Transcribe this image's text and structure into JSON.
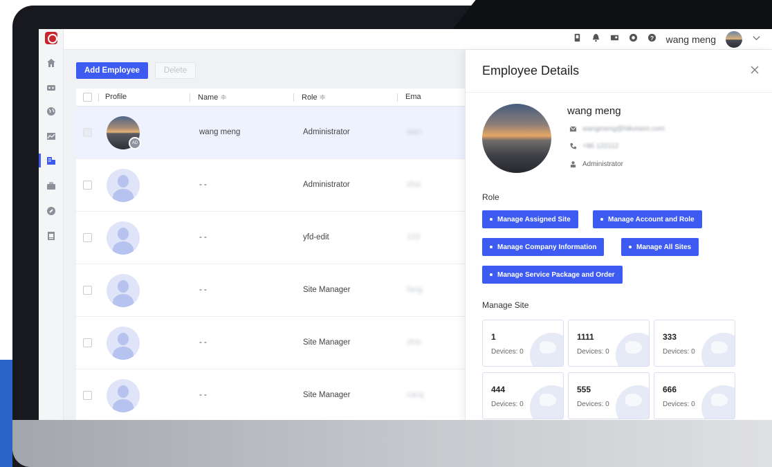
{
  "topbar": {
    "user_name": "wang meng",
    "icons": [
      "device-icon",
      "bell-icon",
      "card-icon",
      "settings-icon",
      "help-icon",
      "chevron-down-icon"
    ]
  },
  "nav": {
    "items": [
      "home-icon",
      "devices-icon",
      "globe-icon",
      "statistics-icon",
      "organization-icon",
      "briefcase-icon",
      "tools-icon",
      "reports-icon"
    ],
    "active": "organization-icon"
  },
  "toolbar": {
    "add_label": "Add Employee",
    "delete_label": "Delete"
  },
  "table": {
    "headers": {
      "profile": "Profile",
      "name": "Name",
      "role": "Role",
      "email": "Ema"
    },
    "sort_glyph": "≑",
    "rows": [
      {
        "name": "wang meng",
        "role": "Administrator",
        "email": "wan",
        "badge": "AD"
      },
      {
        "name": "- -",
        "role": "Administrator",
        "email": "zhsi"
      },
      {
        "name": "- -",
        "role": "yfd-edit",
        "email": "103"
      },
      {
        "name": "- -",
        "role": "Site Manager",
        "email": "fang"
      },
      {
        "name": "- -",
        "role": "Site Manager",
        "email": "zhsi"
      },
      {
        "name": "- -",
        "role": "Site Manager",
        "email": "cacq"
      }
    ]
  },
  "details": {
    "title": "Employee Details",
    "name": "wang meng",
    "email": "wangmeng@hikvision.com",
    "phone": "+86 122112",
    "role": "Administrator",
    "role_heading": "Role",
    "permissions": [
      "Manage Assigned Site",
      "Manage Account and Role",
      "Manage Company Information",
      "Manage All Sites",
      "Manage Service Package and Order"
    ],
    "site_heading": "Manage Site",
    "sites": [
      {
        "name": "1",
        "devices": "Devices: 0"
      },
      {
        "name": "1111",
        "devices": "Devices: 0"
      },
      {
        "name": "333",
        "devices": "Devices: 0"
      },
      {
        "name": "444",
        "devices": "Devices: 0"
      },
      {
        "name": "555",
        "devices": "Devices: 0"
      },
      {
        "name": "666",
        "devices": "Devices: 0"
      }
    ]
  },
  "colors": {
    "accent": "#3d5af1",
    "selected_row": "#eef2ff",
    "frame": "#17191f"
  }
}
